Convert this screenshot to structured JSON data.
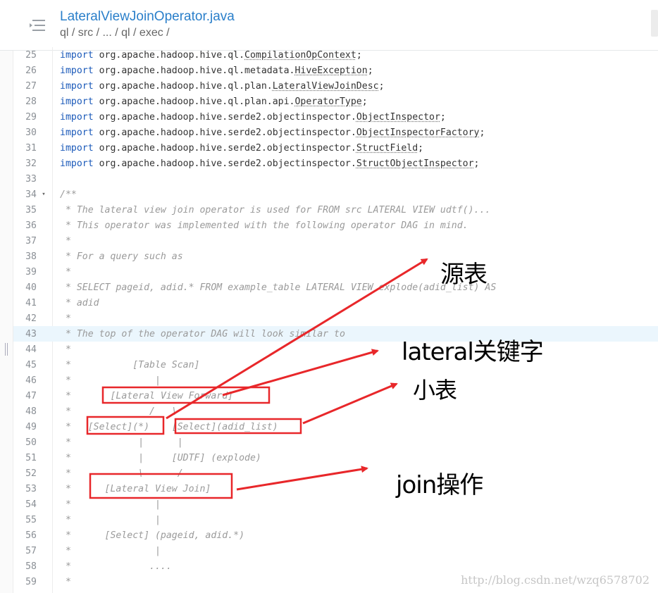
{
  "header": {
    "file_title": "LateralViewJoinOperator.java",
    "breadcrumb": "ql / src / ... / ql / exec /",
    "menu_icon": "menu-collapse-icon"
  },
  "code": {
    "lines": [
      {
        "num": "25",
        "kind": "import",
        "kw": "import",
        "pkg": " org.apache.hadoop.hive.ql.",
        "cls": "CompilationOpContext",
        "end": ";"
      },
      {
        "num": "26",
        "kind": "import",
        "kw": "import",
        "pkg": " org.apache.hadoop.hive.ql.metadata.",
        "cls": "HiveException",
        "end": ";"
      },
      {
        "num": "27",
        "kind": "import",
        "kw": "import",
        "pkg": " org.apache.hadoop.hive.ql.plan.",
        "cls": "LateralViewJoinDesc",
        "end": ";"
      },
      {
        "num": "28",
        "kind": "import",
        "kw": "import",
        "pkg": " org.apache.hadoop.hive.ql.plan.api.",
        "cls": "OperatorType",
        "end": ";"
      },
      {
        "num": "29",
        "kind": "import",
        "kw": "import",
        "pkg": " org.apache.hadoop.hive.serde2.objectinspector.",
        "cls": "ObjectInspector",
        "end": ";"
      },
      {
        "num": "30",
        "kind": "import",
        "kw": "import",
        "pkg": " org.apache.hadoop.hive.serde2.objectinspector.",
        "cls": "ObjectInspectorFactory",
        "end": ";"
      },
      {
        "num": "31",
        "kind": "import",
        "kw": "import",
        "pkg": " org.apache.hadoop.hive.serde2.objectinspector.",
        "cls": "StructField",
        "end": ";"
      },
      {
        "num": "32",
        "kind": "import",
        "kw": "import",
        "pkg": " org.apache.hadoop.hive.serde2.objectinspector.",
        "cls": "StructObjectInspector",
        "end": ";"
      },
      {
        "num": "33",
        "kind": "blank",
        "text": ""
      },
      {
        "num": "34",
        "kind": "comment",
        "fold": "▾",
        "text": "/**"
      },
      {
        "num": "35",
        "kind": "comment",
        "text": " * The lateral view join operator is used for FROM src LATERAL VIEW udtf()..."
      },
      {
        "num": "36",
        "kind": "comment",
        "text": " * This operator was implemented with the following operator DAG in mind."
      },
      {
        "num": "37",
        "kind": "comment",
        "text": " *"
      },
      {
        "num": "38",
        "kind": "comment",
        "text": " * For a query such as"
      },
      {
        "num": "39",
        "kind": "comment",
        "text": " *"
      },
      {
        "num": "40",
        "kind": "comment",
        "text": " * SELECT pageid, adid.* FROM example_table LATERAL VIEW explode(adid_list) AS"
      },
      {
        "num": "41",
        "kind": "comment",
        "text": " * adid"
      },
      {
        "num": "42",
        "kind": "comment",
        "text": " *"
      },
      {
        "num": "43",
        "kind": "comment",
        "highlight": true,
        "text": " * The top of the operator DAG will look similar to"
      },
      {
        "num": "44",
        "kind": "comment",
        "text": " *"
      },
      {
        "num": "45",
        "kind": "comment",
        "text": " *           [Table Scan]"
      },
      {
        "num": "46",
        "kind": "comment",
        "text": " *               |"
      },
      {
        "num": "47",
        "kind": "comment",
        "text": " *       [Lateral View Forward]"
      },
      {
        "num": "48",
        "kind": "comment",
        "text": " *              /   \\"
      },
      {
        "num": "49",
        "kind": "comment",
        "text": " *   [Select](*)    [Select](adid_list)"
      },
      {
        "num": "50",
        "kind": "comment",
        "text": " *            |      |"
      },
      {
        "num": "51",
        "kind": "comment",
        "text": " *            |     [UDTF] (explode)"
      },
      {
        "num": "52",
        "kind": "comment",
        "text": " *            \\      /"
      },
      {
        "num": "53",
        "kind": "comment",
        "text": " *      [Lateral View Join]"
      },
      {
        "num": "54",
        "kind": "comment",
        "text": " *               |"
      },
      {
        "num": "55",
        "kind": "comment",
        "text": " *               |"
      },
      {
        "num": "56",
        "kind": "comment",
        "text": " *      [Select] (pageid, adid.*)"
      },
      {
        "num": "57",
        "kind": "comment",
        "text": " *               |"
      },
      {
        "num": "58",
        "kind": "comment",
        "text": " *              ...."
      },
      {
        "num": "59",
        "kind": "comment",
        "text": " *"
      }
    ]
  },
  "annotations": {
    "source_table": "源表",
    "lateral_keyword": "lateral关键字",
    "small_table": "小表",
    "join_operation": "join操作",
    "color": "#e8272a"
  },
  "watermark": "http://blog.csdn.net/wzq6578702",
  "colors": {
    "title_link": "#2a7fca",
    "keyword": "#1a59b9",
    "comment": "#9a9a9a",
    "highlight_row": "#ebf6fd"
  }
}
